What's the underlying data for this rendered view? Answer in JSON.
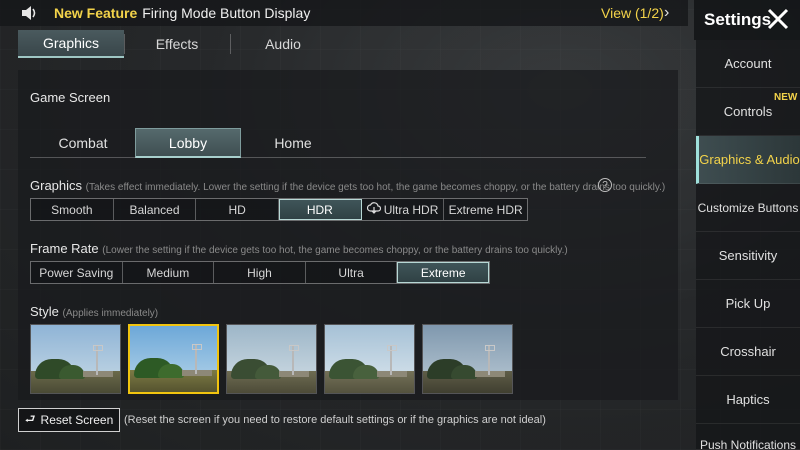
{
  "notice": {
    "feature_label": "New Feature",
    "message": "Firing Mode Button Display",
    "view_label": "View (1/2)"
  },
  "tabs": [
    {
      "label": "Graphics",
      "active": true
    },
    {
      "label": "Effects",
      "active": false
    },
    {
      "label": "Audio",
      "active": false
    }
  ],
  "game_screen": {
    "title": "Game Screen",
    "subtabs": [
      {
        "label": "Combat",
        "active": false
      },
      {
        "label": "Lobby",
        "active": true
      },
      {
        "label": "Home",
        "active": false
      }
    ]
  },
  "graphics": {
    "title": "Graphics",
    "note": "(Takes effect immediately. Lower the setting if the device gets too hot, the game becomes choppy, or the battery drains too quickly.)",
    "options": [
      "Smooth",
      "Balanced",
      "HD",
      "HDR",
      "Ultra HDR",
      "Extreme HDR"
    ],
    "selected": "HDR"
  },
  "frame_rate": {
    "title": "Frame Rate",
    "note": "(Lower the setting if the device gets too hot, the game becomes choppy, or the battery drains too quickly.)",
    "options": [
      "Power Saving",
      "Medium",
      "High",
      "Ultra",
      "Extreme"
    ],
    "selected": "Extreme"
  },
  "style": {
    "title": "Style",
    "note": "(Applies immediately)",
    "selected_index": 1,
    "count": 5
  },
  "reset": {
    "label": "Reset Screen",
    "note": "(Reset the screen if you need to restore default settings or if the graphics are not ideal)"
  },
  "sidebar": {
    "title": "Settings",
    "new_badge": "NEW",
    "items": [
      {
        "label": "Account",
        "active": false
      },
      {
        "label": "Controls",
        "active": false
      },
      {
        "label": "Graphics & Audio",
        "active": true
      },
      {
        "label": "Customize Buttons",
        "active": false
      },
      {
        "label": "Sensitivity",
        "active": false
      },
      {
        "label": "Pick Up",
        "active": false
      },
      {
        "label": "Crosshair",
        "active": false
      },
      {
        "label": "Haptics",
        "active": false
      },
      {
        "label": "Push Notifications",
        "active": false
      }
    ]
  },
  "colors": {
    "accent_yellow": "#f3d34a",
    "selected_border": "#b7d8d5",
    "style_selected": "#f1c40f"
  }
}
